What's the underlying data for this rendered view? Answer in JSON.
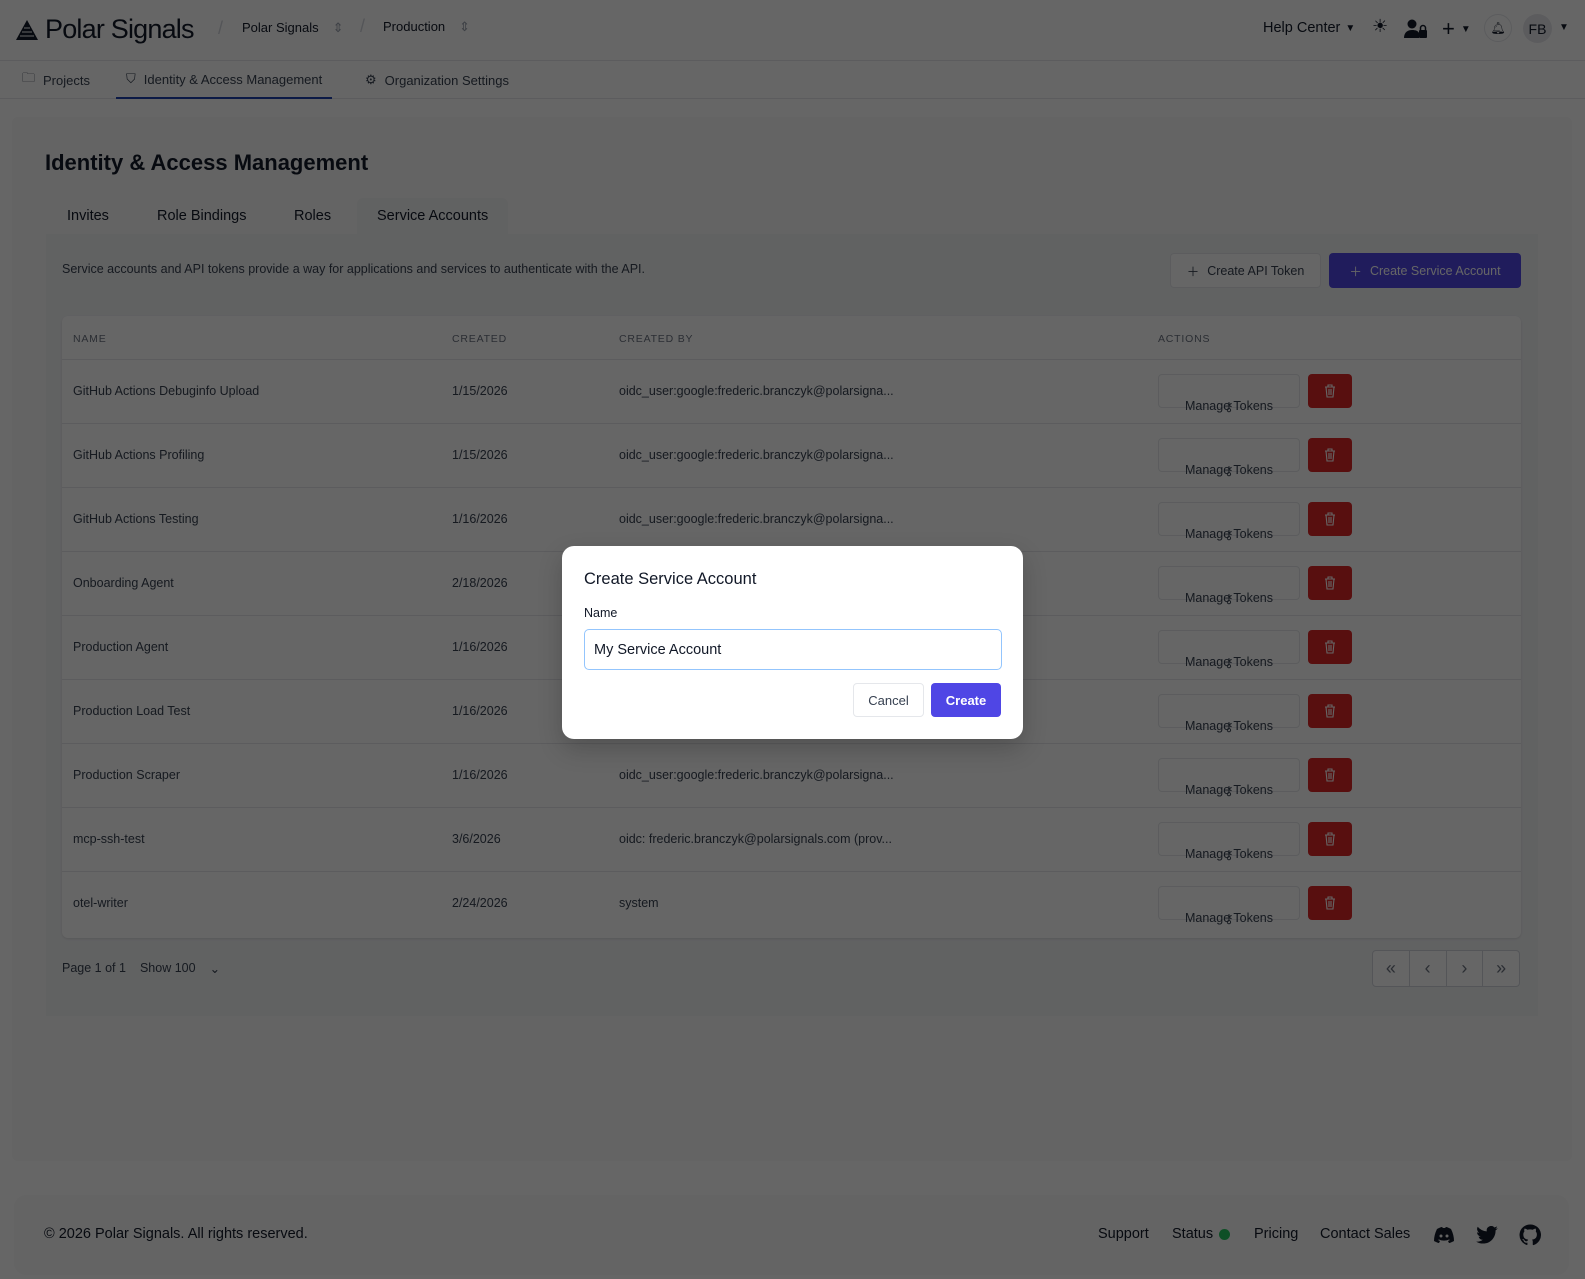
{
  "header": {
    "brand": "Polar Signals",
    "org": "Polar Signals",
    "project": "Production",
    "help": "Help Center",
    "avatar": "FB"
  },
  "subnav": [
    {
      "label": "Projects",
      "icon": "folder-icon"
    },
    {
      "label": "Identity & Access Management",
      "icon": "shield-icon",
      "active": true
    },
    {
      "label": "Organization Settings",
      "icon": "gear-icon"
    }
  ],
  "page": {
    "title": "Identity & Access Management",
    "tabs": [
      "Invites",
      "Role Bindings",
      "Roles",
      "Service Accounts"
    ],
    "active_tab": "Service Accounts",
    "description": "Service accounts and API tokens provide a way for applications and services to authenticate with the API.",
    "create_token": "Create API Token",
    "create_sa": "Create Service Account"
  },
  "table": {
    "headers": [
      "NAME",
      "CREATED",
      "CREATED BY",
      "ACTIONS"
    ],
    "manage": "Manage Tokens",
    "rows": [
      [
        "GitHub Actions Debuginfo Upload",
        "1/15/2026",
        "oidc_user:google:frederic.branczyk@polarsigna..."
      ],
      [
        "GitHub Actions Profiling",
        "1/15/2026",
        "oidc_user:google:frederic.branczyk@polarsigna..."
      ],
      [
        "GitHub Actions Testing",
        "1/16/2026",
        "oidc_user:google:frederic.branczyk@polarsigna..."
      ],
      [
        "Onboarding Agent",
        "2/18/2026",
        ""
      ],
      [
        "Production Agent",
        "1/16/2026",
        ""
      ],
      [
        "Production Load Test",
        "1/16/2026",
        ""
      ],
      [
        "Production Scraper",
        "1/16/2026",
        "oidc_user:google:frederic.branczyk@polarsigna..."
      ],
      [
        "mcp-ssh-test",
        "3/6/2026",
        "oidc: frederic.branczyk@polarsignals.com (prov..."
      ],
      [
        "otel-writer",
        "2/24/2026",
        "system"
      ]
    ]
  },
  "pagination": {
    "page": "Page 1 of 1",
    "show": "Show 100"
  },
  "footer": {
    "copyright": "© 2026 Polar Signals. All rights reserved.",
    "links": [
      "Support",
      "Status",
      "Pricing",
      "Contact Sales"
    ],
    "status_color": "#22c55e"
  },
  "modal": {
    "title": "Create Service Account",
    "label": "Name",
    "value": "My Service Account",
    "cancel": "Cancel",
    "create": "Create"
  },
  "colors": {
    "primary": "#4f46e5",
    "danger": "#dc2626"
  }
}
